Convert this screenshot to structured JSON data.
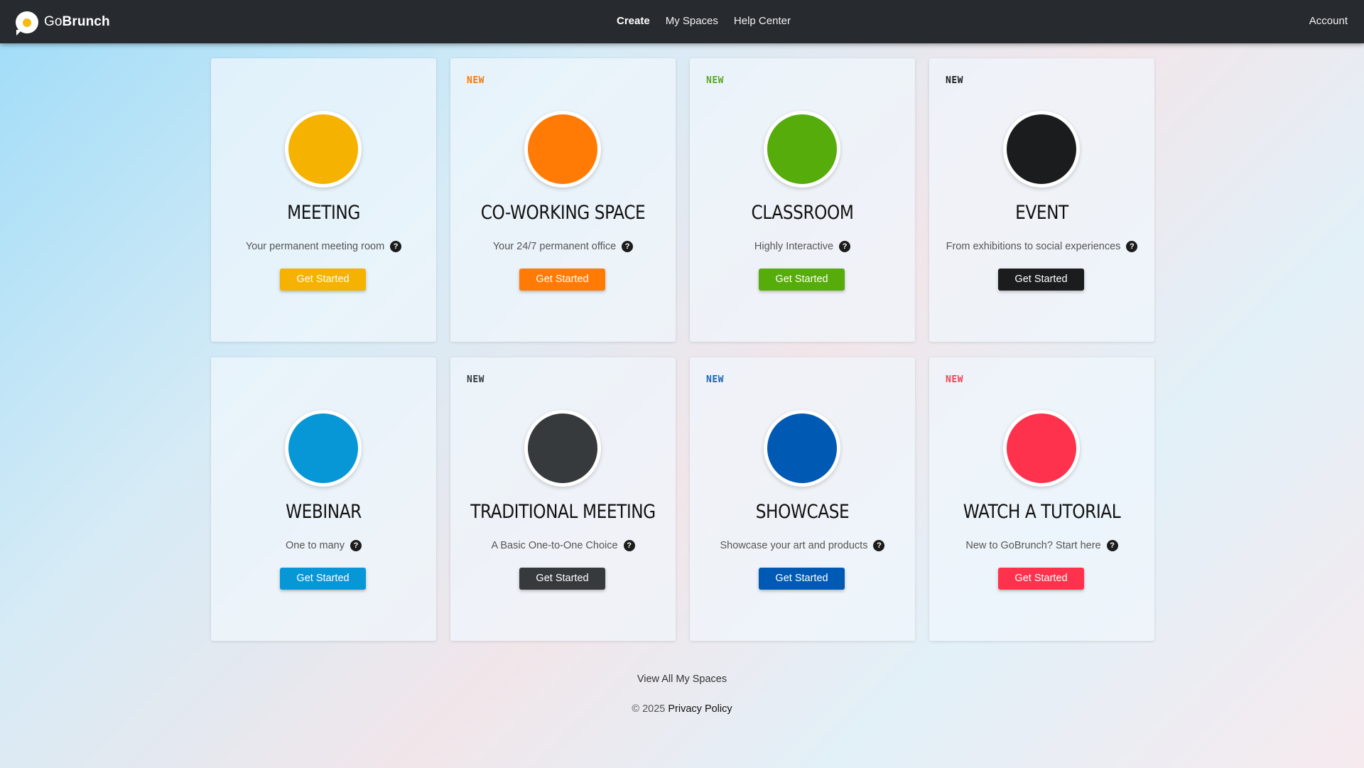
{
  "app": {
    "brand_go": "Go",
    "brand_brunch": "Brunch",
    "brand_accent": "#f6bb13"
  },
  "nav": {
    "items": [
      {
        "label": "Create",
        "active": true
      },
      {
        "label": "My Spaces",
        "active": false
      },
      {
        "label": "Help Center",
        "active": false
      }
    ],
    "account": "Account"
  },
  "cards": [
    {
      "badge": "",
      "title": "MEETING",
      "description": "Your permanent meeting room",
      "button": "Get Started",
      "color": "#f6b200",
      "badge_color": "#f6b200"
    },
    {
      "badge": "NEW",
      "title": "CO-WORKING SPACE",
      "description": "Your 24/7 permanent office",
      "button": "Get Started",
      "color": "#ff7b06",
      "badge_color": "#ef7a12"
    },
    {
      "badge": "NEW",
      "title": "CLASSROOM",
      "description": "Highly Interactive",
      "button": "Get Started",
      "color": "#55ac0a",
      "badge_color": "#5aa820"
    },
    {
      "badge": "NEW",
      "title": "EVENT",
      "description": "From exhibitions to social experiences",
      "button": "Get Started",
      "color": "#1a1c1e",
      "badge_color": "#1a1c1e"
    },
    {
      "badge": "",
      "title": "WEBINAR",
      "description": "One to many",
      "button": "Get Started",
      "color": "#0797d6",
      "badge_color": "#0797d6"
    },
    {
      "badge": "NEW",
      "title": "TRADITIONAL MEETING",
      "description": "A Basic One-to-One Choice",
      "button": "Get Started",
      "color": "#363a3d",
      "badge_color": "#363a3d"
    },
    {
      "badge": "NEW",
      "title": "SHOWCASE",
      "description": "Showcase your art and products",
      "button": "Get Started",
      "color": "#005ab4",
      "badge_color": "#1f65b0"
    },
    {
      "badge": "NEW",
      "title": "WATCH A TUTORIAL",
      "description": "New to GoBrunch? Start here",
      "button": "Get Started",
      "color": "#ff324d",
      "badge_color": "#ef4256"
    }
  ],
  "footer": {
    "view_all": "View All My Spaces",
    "copyright": "© 2025",
    "privacy": "Privacy Policy"
  },
  "help_icon_glyph": "?"
}
